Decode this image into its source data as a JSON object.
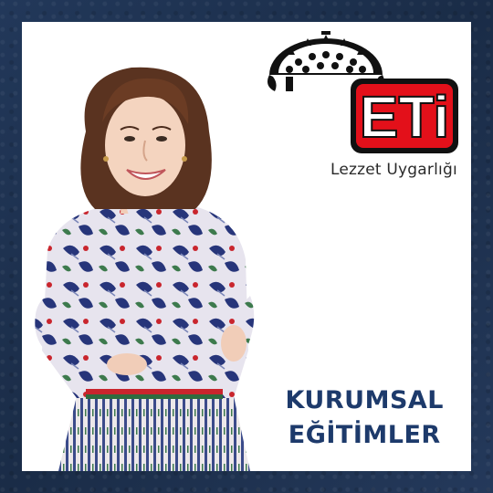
{
  "brand": {
    "logo_text": "ETi",
    "tagline": "Lezzet Uygarlığı"
  },
  "headline": {
    "line1": "KURUMSAL",
    "line2": "EĞİTİMLER"
  },
  "colors": {
    "background": "#1f3350",
    "card": "#ffffff",
    "logo_red": "#e3101a",
    "headline": "#1d3a6b"
  },
  "icons": [
    "sunburst-emblem-icon"
  ]
}
